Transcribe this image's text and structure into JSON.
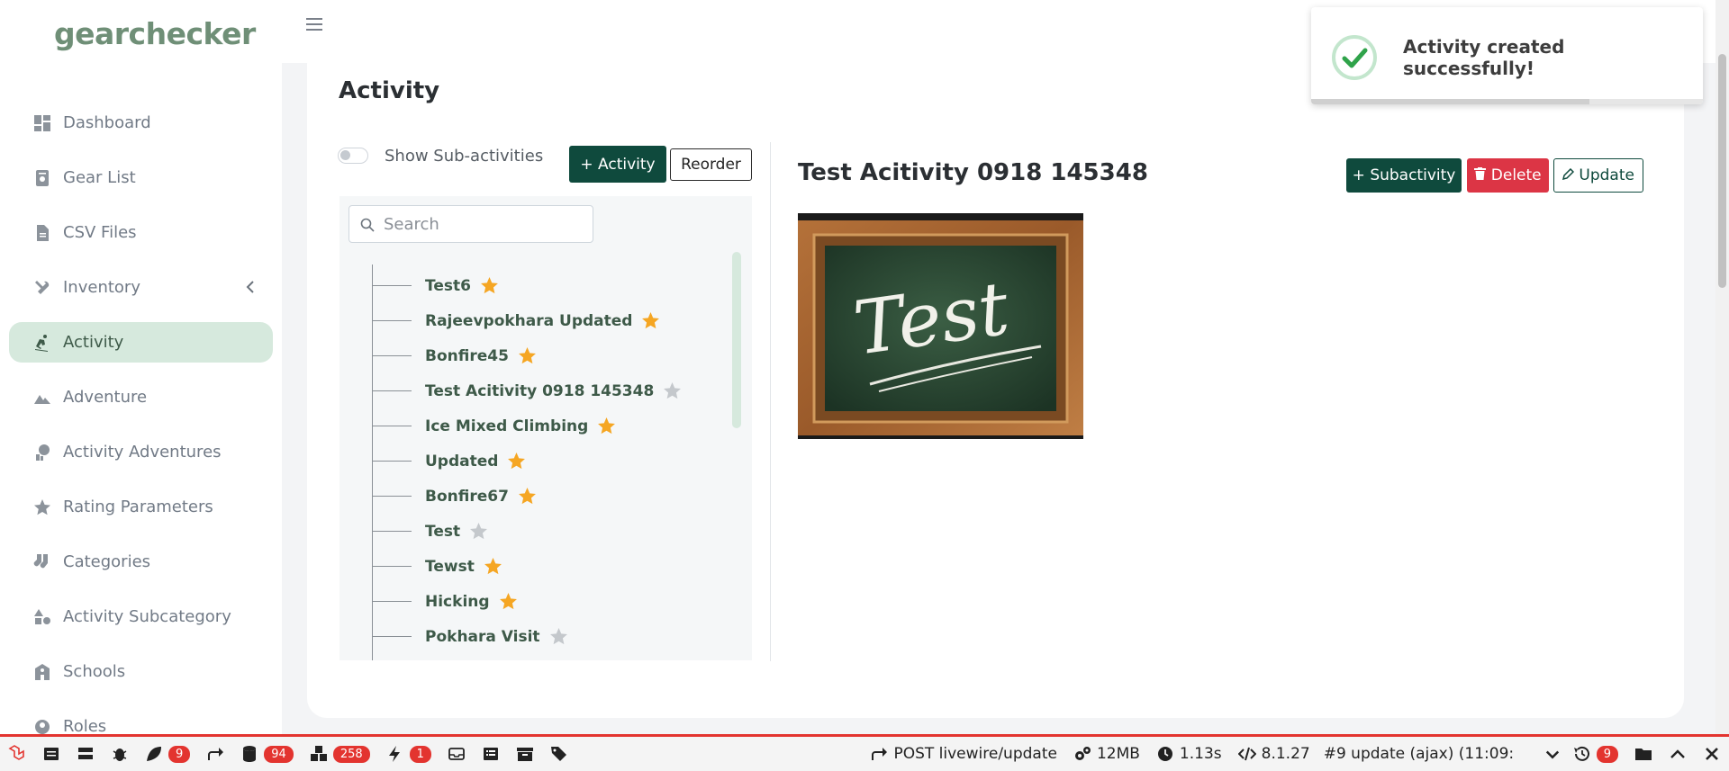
{
  "brand": {
    "logo": "gearchecker"
  },
  "sidebar": {
    "items": [
      {
        "label": "Dashboard",
        "icon": "dashboard-icon",
        "active": false
      },
      {
        "label": "Gear List",
        "icon": "gear-list-icon",
        "active": false
      },
      {
        "label": "CSV Files",
        "icon": "file-icon",
        "active": false
      },
      {
        "label": "Inventory",
        "icon": "tools-icon",
        "active": false,
        "has_chevron": true
      },
      {
        "label": "Activity",
        "icon": "skiing-icon",
        "active": true
      },
      {
        "label": "Adventure",
        "icon": "mountain-icon",
        "active": false
      },
      {
        "label": "Activity Adventures",
        "icon": "activity-adventures-icon",
        "active": false
      },
      {
        "label": "Rating Parameters",
        "icon": "star-rating-icon",
        "active": false
      },
      {
        "label": "Categories",
        "icon": "socks-icon",
        "active": false
      },
      {
        "label": "Activity Subcategory",
        "icon": "shapes-icon",
        "active": false
      },
      {
        "label": "Schools",
        "icon": "school-icon",
        "active": false
      },
      {
        "label": "Roles",
        "icon": "roles-icon",
        "active": false
      }
    ]
  },
  "page": {
    "title": "Activity"
  },
  "toolbar": {
    "toggle_label": "Show Sub-activities",
    "add_activity_label": "+ Activity",
    "reorder_label": "Reorder"
  },
  "search": {
    "placeholder": "Search",
    "value": ""
  },
  "tree": {
    "items": [
      {
        "label": "Test6",
        "starred": true
      },
      {
        "label": "Rajeevpokhara Updated",
        "starred": true
      },
      {
        "label": "Bonfire45",
        "starred": true
      },
      {
        "label": "Test Acitivity 0918 145348",
        "starred": false
      },
      {
        "label": "Ice Mixed Climbing",
        "starred": true
      },
      {
        "label": "Updated",
        "starred": true
      },
      {
        "label": "Bonfire67",
        "starred": true
      },
      {
        "label": "Test",
        "starred": false
      },
      {
        "label": "Tewst",
        "starred": true
      },
      {
        "label": "Hicking",
        "starred": true
      },
      {
        "label": "Pokhara Visit",
        "starred": false
      }
    ]
  },
  "detail": {
    "title": "Test Acitivity 0918 145348",
    "subactivity_label": "Subactivity",
    "delete_label": "Delete",
    "update_label": "Update",
    "image_text": "Test"
  },
  "toast": {
    "message": "Activity created successfully!",
    "progress": 0.71
  },
  "debugbar": {
    "badges": {
      "views": "9",
      "queries": "94",
      "models": "258",
      "events": "1"
    },
    "request": "POST livewire/update",
    "memory": "12MB",
    "time": "1.13s",
    "php": "8.1.27",
    "selected_request": "#9 update (ajax) (11:09:",
    "history_count": "9"
  },
  "colors": {
    "brand_green": "#0f4a3d",
    "label_green": "#3e5a49",
    "active_bg": "#d6e9dd",
    "star_on": "#f5a623",
    "star_off": "#c4c8cc",
    "danger": "#dc3545",
    "debug_red": "#e3342f"
  }
}
